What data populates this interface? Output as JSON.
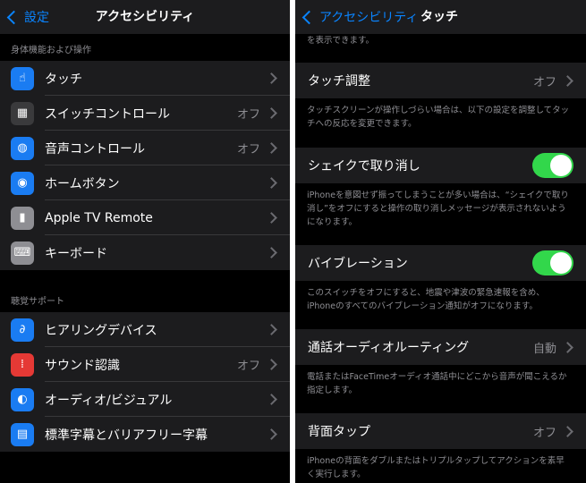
{
  "left": {
    "nav": {
      "back_label": "設定",
      "title": "アクセシビリティ"
    },
    "section1_header": "身体機能および操作",
    "section1_items": [
      {
        "label": "タッチ",
        "value": "",
        "icon": "hand-pointer-icon",
        "icon_color": "#1a7cf2",
        "glyph": "☝"
      },
      {
        "label": "スイッチコントロール",
        "value": "オフ",
        "icon": "switch-control-icon",
        "icon_color": "#3a3a3c",
        "glyph": "▦"
      },
      {
        "label": "音声コントロール",
        "value": "オフ",
        "icon": "voice-control-icon",
        "icon_color": "#1a7cf2",
        "glyph": "◍"
      },
      {
        "label": "ホームボタン",
        "value": "",
        "icon": "home-button-icon",
        "icon_color": "#1a7cf2",
        "glyph": "◉"
      },
      {
        "label": "Apple TV Remote",
        "value": "",
        "icon": "remote-icon",
        "icon_color": "#8e8e93",
        "glyph": "▮"
      },
      {
        "label": "キーボード",
        "value": "",
        "icon": "keyboard-icon",
        "icon_color": "#8e8e93",
        "glyph": "⌨"
      }
    ],
    "section2_header": "聴覚サポート",
    "section2_items": [
      {
        "label": "ヒアリングデバイス",
        "value": "",
        "icon": "ear-icon",
        "icon_color": "#1a7cf2",
        "glyph": "∂"
      },
      {
        "label": "サウンド認識",
        "value": "オフ",
        "icon": "sound-recognition-icon",
        "icon_color": "#e53935",
        "glyph": "⁞"
      },
      {
        "label": "オーディオ/ビジュアル",
        "value": "",
        "icon": "audio-visual-icon",
        "icon_color": "#1a7cf2",
        "glyph": "◐"
      },
      {
        "label": "標準字幕とバリアフリー字幕",
        "value": "",
        "icon": "captions-icon",
        "icon_color": "#1a7cf2",
        "glyph": "▤"
      }
    ]
  },
  "right": {
    "nav": {
      "back_label": "アクセシビリティ",
      "title": "タッチ"
    },
    "top_note": "を表示できます。",
    "touch_accommodations": {
      "label": "タッチ調整",
      "value": "オフ",
      "footer": "タッチスクリーンが操作しづらい場合は、以下の設定を調整してタッチへの反応を変更できます。"
    },
    "shake_to_undo": {
      "label": "シェイクで取り消し",
      "on": true,
      "footer": "iPhoneを意図せず振ってしまうことが多い場合は、“シェイクで取り消し”をオフにすると操作の取り消しメッセージが表示されないようになります。"
    },
    "vibration": {
      "label": "バイブレーション",
      "on": true,
      "footer": "このスイッチをオフにすると、地震や津波の緊急速報を含め、iPhoneのすべてのバイブレーション通知がオフになります。"
    },
    "call_audio_routing": {
      "label": "通話オーディオルーティング",
      "value": "自動",
      "footer": "電話またはFaceTimeオーディオ通話中にどこから音声が聞こえるか指定します。"
    },
    "back_tap": {
      "label": "背面タップ",
      "value": "オフ",
      "footer": "iPhoneの背面をダブルまたはトリプルタップしてアクションを素早く実行します。"
    }
  }
}
